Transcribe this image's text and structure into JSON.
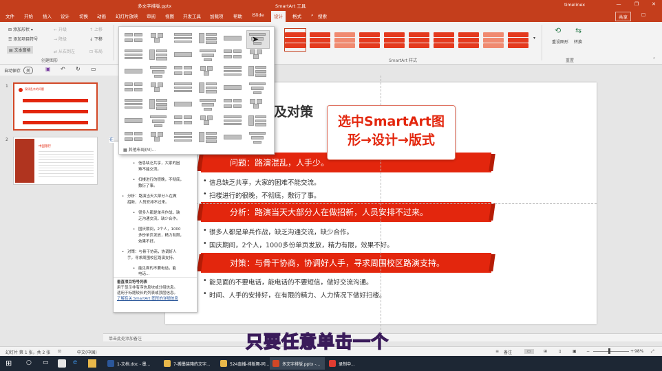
{
  "titlebar": {
    "filename": "多文字排版.pptx",
    "context_tool": "SmartArt 工具",
    "user": "timelinex",
    "minimize": "—",
    "restore": "❐",
    "close": "✕"
  },
  "tabs": [
    "文件",
    "开始",
    "插入",
    "设计",
    "切换",
    "动画",
    "幻灯片放映",
    "审阅",
    "视图",
    "开发工具",
    "加载项",
    "帮助",
    "iSlide",
    "设计",
    "格式"
  ],
  "tell_me": "搜索",
  "share": "共享",
  "ribbon": {
    "create_graphic": {
      "add_shape": "添加形状",
      "add_bullet": "添加项目符号",
      "text_pane": "文本窗格",
      "promote": "升级",
      "demote": "降级",
      "right_to_left": "从右到左",
      "move_up": "上移",
      "move_down": "下移",
      "layout": "布局",
      "group_label": "创建图形"
    },
    "styles_group_label": "SmartArt 样式",
    "reset": {
      "reset_graphic": "重设图形",
      "convert": "转换",
      "group_label": "重置"
    }
  },
  "qat": {
    "autosave": "自动保存",
    "toggle": "关"
  },
  "thumbnails": [
    {
      "num": "1",
      "title": "现场乱杂的问题"
    },
    {
      "num": "2",
      "title": "中国银行"
    }
  ],
  "slide": {
    "title_fragment": "及对策",
    "banners": [
      "问题：路演混乱，人手少。",
      "分析：路演当天大部分人在做招新，人员安排不过来。",
      "对策：与骨干协商，协调好人手，寻求周围校区路演支持。"
    ],
    "bullets": [
      "信息缺乏共享，大家的困难不能交流。",
      "扫楼进行的很晚，不彻底，敷衍了事。",
      "很多人都是单兵作战，缺乏沟通交流，缺少合作。",
      "国庆期间，2个人，1000多份单页发放，精力有限，效果不好。",
      "能见面的不要电话，能电话的不要短信，做好交流沟通。",
      "时间、人手的安排好，在有限的精力、人力情况下做好扫楼。"
    ]
  },
  "callout": {
    "line1": "选中SmartArt图",
    "line2": "形→设计→版式"
  },
  "text_pane": {
    "lines": [
      "信息缺乏共享，大家的困",
      "难不能交流。",
      "扫楼进行的很晚，不彻底，",
      "敷衍了事。",
      "分析：路演当天大部分人在做",
      "招新，人员安排不过来。",
      "很多人都是单兵作战，缺",
      "乏沟通交流，缺少合作。",
      "国庆期间，2个人，1000",
      "多份单页发放，精力有限，",
      "效果不好。",
      "对策：与骨干协商，协调好人",
      "手，寻求周围校区路演支持。",
      "能见面的不要电话，能",
      "电话..."
    ],
    "footer_title": "垂直项目符号列表",
    "footer_desc1": "用于显示非有序信息块或分组信息。",
    "footer_desc2": "适用于标题较长的列表或顶层信息。",
    "footer_link": "了解有关 SmartArt 图形的详细信息"
  },
  "gallery": {
    "more_layouts": "其他布局(M)..."
  },
  "notes": {
    "placeholder": "单击此处添加备注"
  },
  "status": {
    "slide_info": "幻灯片 第 1 张，共 2 张",
    "language": "中文(中国)",
    "notes_btn": "备注",
    "zoom": "98%"
  },
  "subtitle": "只要任意单击一个",
  "taskbar": {
    "items": [
      "1-文档.doc - 墨...",
      "7-搬墨装箱的文字...",
      "524直播-排版舞-同...",
      "多文字排版.pptx -...",
      "录制中..."
    ]
  },
  "colors": {
    "accent": "#c43e1c",
    "banner": "#e3260d",
    "callout_text": "#e3260d"
  }
}
